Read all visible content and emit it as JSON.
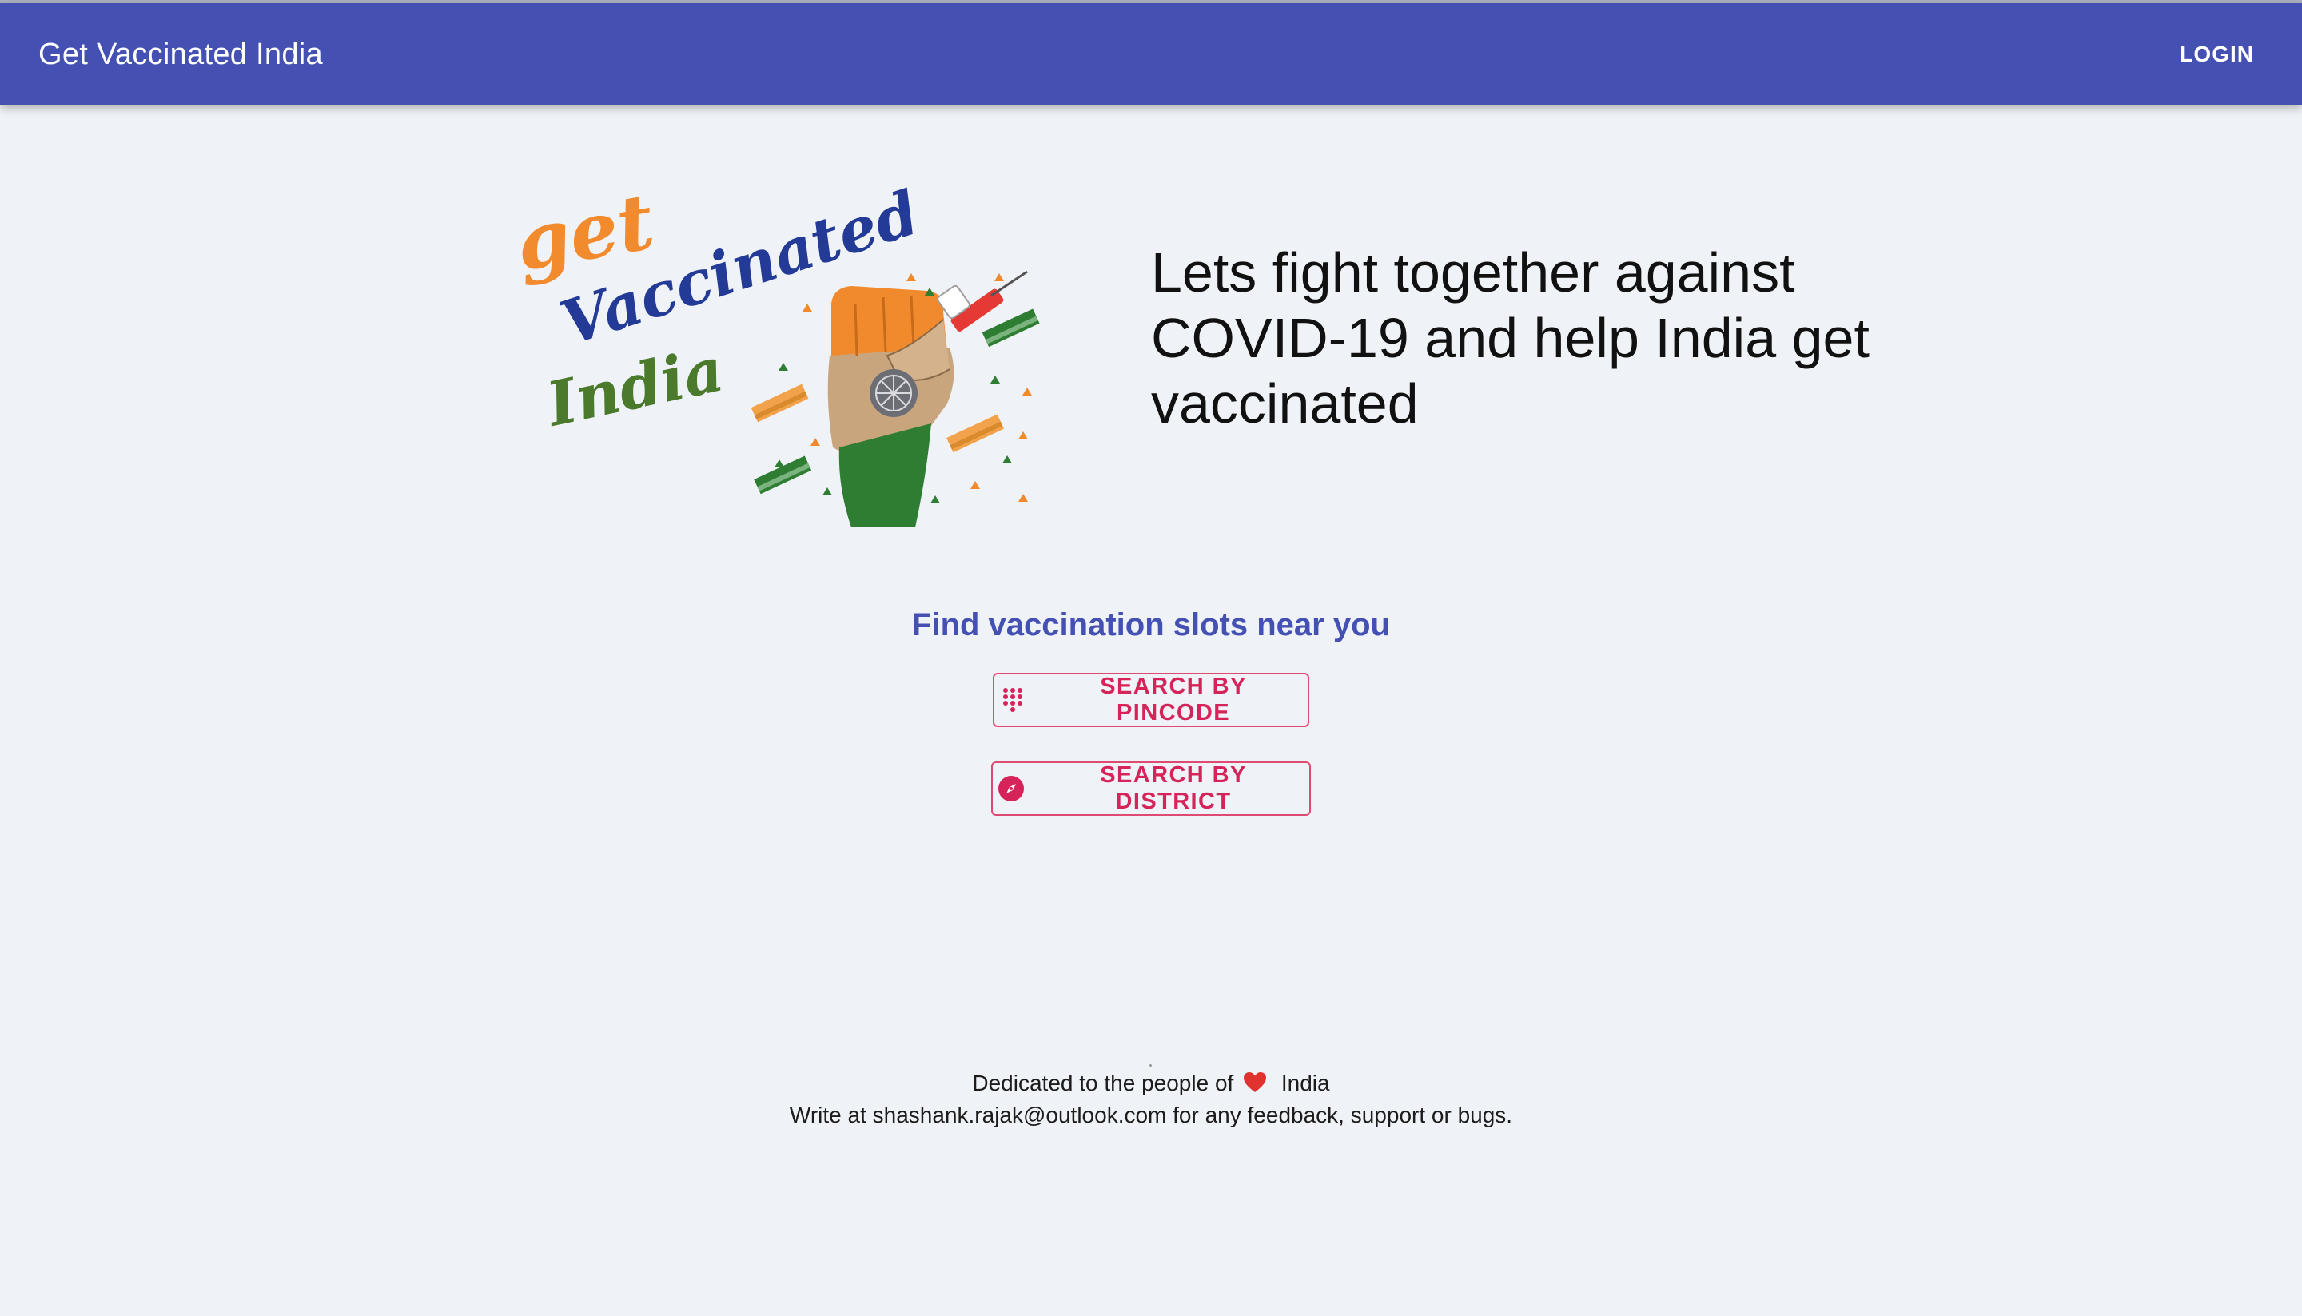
{
  "appbar": {
    "title": "Get Vaccinated India",
    "login_label": "LOGIN",
    "color": "#4451b3"
  },
  "hero": {
    "logo": {
      "word1": "get",
      "word2": "Vaccinated",
      "word3": "India",
      "colors": {
        "saffron": "#f28a2e",
        "navy": "#233a96",
        "green": "#3f7a2a"
      }
    },
    "heading": "Lets fight together against COVID-19 and help India get vaccinated"
  },
  "search": {
    "title": "Find vaccination slots near you",
    "pincode_label": "SEARCH BY PINCODE",
    "pincode_icon": "dialpad-icon",
    "district_label": "SEARCH BY DISTRICT",
    "district_icon": "compass-icon",
    "accent_color": "#d6245a"
  },
  "footer": {
    "dedication_prefix": "Dedicated to the people of",
    "heart_icon": "heart-icon",
    "dedication_suffix": "India",
    "contact": "Write at shashank.rajak@outlook.com for any feedback, support or bugs."
  }
}
